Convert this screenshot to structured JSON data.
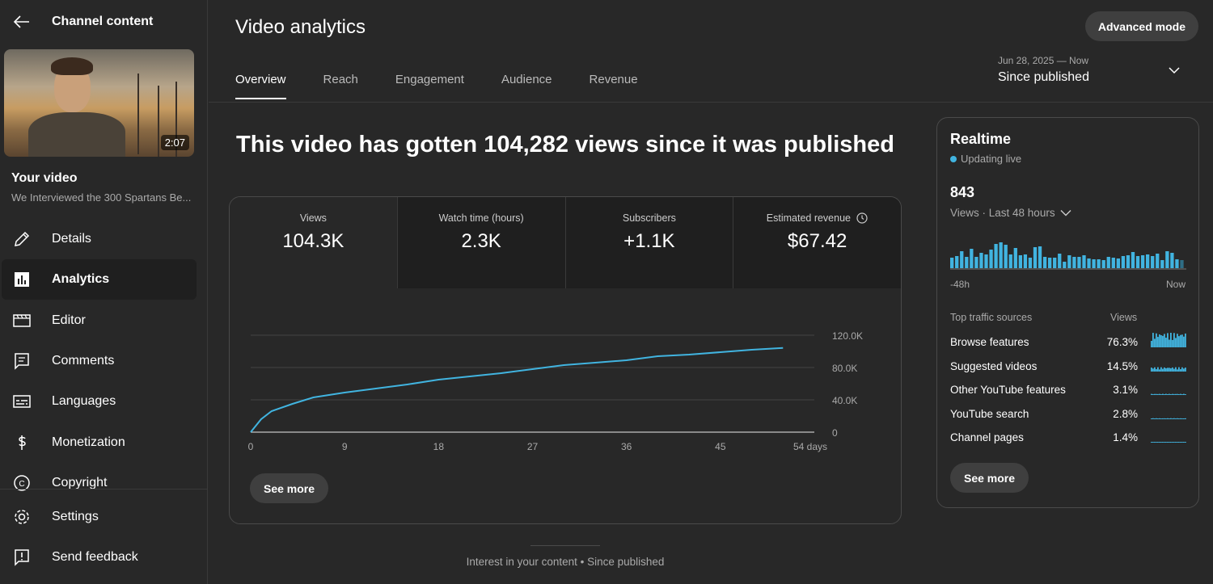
{
  "sidebar": {
    "title": "Channel content",
    "thumbnail": {
      "duration": "2:07"
    },
    "your_video": "Your video",
    "video_title": "We Interviewed the 300 Spartans Be...",
    "items": [
      {
        "label": "Details",
        "icon": "pencil-icon"
      },
      {
        "label": "Analytics",
        "icon": "analytics-icon",
        "active": true
      },
      {
        "label": "Editor",
        "icon": "clapperboard-icon"
      },
      {
        "label": "Comments",
        "icon": "comment-icon"
      },
      {
        "label": "Languages",
        "icon": "subtitles-icon"
      },
      {
        "label": "Monetization",
        "icon": "dollar-icon"
      },
      {
        "label": "Copyright",
        "icon": "copyright-icon"
      }
    ],
    "bottom": [
      {
        "label": "Settings",
        "icon": "gear-icon"
      },
      {
        "label": "Send feedback",
        "icon": "feedback-icon"
      }
    ]
  },
  "header": {
    "title": "Video analytics",
    "advanced": "Advanced mode",
    "tabs": [
      "Overview",
      "Reach",
      "Engagement",
      "Audience",
      "Revenue"
    ],
    "period": {
      "dates": "Jun 28, 2025 — Now",
      "label": "Since published"
    }
  },
  "overview": {
    "headline": "This video has gotten 104,282 views since it was published",
    "metrics": [
      {
        "label": "Views",
        "value": "104.3K"
      },
      {
        "label": "Watch time (hours)",
        "value": "2.3K"
      },
      {
        "label": "Subscribers",
        "value": "+1.1K"
      },
      {
        "label": "Estimated revenue",
        "value": "$67.42"
      }
    ],
    "see_more": "See more",
    "footer": "Interest in your content • Since published"
  },
  "chart_data": {
    "type": "line",
    "x": [
      0,
      1,
      2,
      4,
      6,
      9,
      12,
      15,
      18,
      21,
      24,
      27,
      30,
      33,
      36,
      39,
      42,
      45,
      48,
      51
    ],
    "y": [
      0,
      16000,
      26000,
      35000,
      43000,
      49000,
      54000,
      59000,
      65000,
      69000,
      73000,
      78000,
      83000,
      86000,
      89000,
      94000,
      96000,
      99000,
      102000,
      104282
    ],
    "xticks": [
      "0",
      "9",
      "18",
      "27",
      "36",
      "45",
      "54 days"
    ],
    "xtick_values": [
      0,
      9,
      18,
      27,
      36,
      45,
      54
    ],
    "yticks": [
      "0",
      "40.0K",
      "80.0K",
      "120.0K"
    ],
    "ytick_values": [
      0,
      40000,
      80000,
      120000
    ],
    "xlim": [
      0,
      54
    ],
    "ylim": [
      0,
      120000
    ],
    "color": "#41b4e0"
  },
  "realtime": {
    "title": "Realtime",
    "live": "Updating live",
    "views": "843",
    "views_label": "Views · Last 48 hours",
    "bars": [
      13,
      15,
      21,
      14,
      24,
      14,
      19,
      17,
      23,
      30,
      32,
      29,
      17,
      25,
      16,
      17,
      13,
      26,
      27,
      14,
      13,
      13,
      18,
      8,
      16,
      14,
      14,
      16,
      12,
      11,
      11,
      10,
      14,
      13,
      12,
      15,
      16,
      20,
      15,
      16,
      17,
      15,
      18,
      10,
      21,
      19,
      11,
      10
    ],
    "start": "-48h",
    "end": "Now",
    "sources_header": "Top traffic sources",
    "views_header": "Views",
    "sources": [
      {
        "name": "Browse features",
        "pct": "76.3%",
        "level": 1
      },
      {
        "name": "Suggested videos",
        "pct": "14.5%",
        "level": 0.3
      },
      {
        "name": "Other YouTube features",
        "pct": "3.1%",
        "level": 0.08
      },
      {
        "name": "YouTube search",
        "pct": "2.8%",
        "level": 0.07
      },
      {
        "name": "Channel pages",
        "pct": "1.4%",
        "level": 0.04
      }
    ],
    "see_more": "See more"
  }
}
